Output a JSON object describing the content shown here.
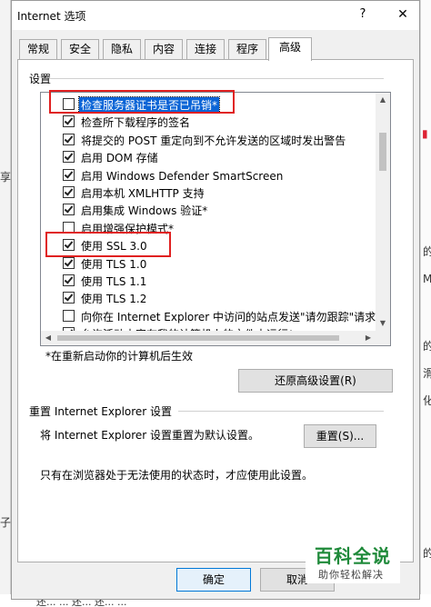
{
  "window": {
    "title": "Internet 选项",
    "help_glyph": "?",
    "close_glyph": "✕"
  },
  "tabs": [
    {
      "label": "常规"
    },
    {
      "label": "安全"
    },
    {
      "label": "隐私"
    },
    {
      "label": "内容"
    },
    {
      "label": "连接"
    },
    {
      "label": "程序"
    },
    {
      "label": "高级"
    }
  ],
  "active_tab": "高级",
  "settings_group_label": "设置",
  "settings": [
    {
      "label": "检查服务器证书是否已吊销*",
      "checked": false,
      "selected": true
    },
    {
      "label": "检查所下载程序的签名",
      "checked": true
    },
    {
      "label": "将提交的 POST 重定向到不允许发送的区域时发出警告",
      "checked": true
    },
    {
      "label": "启用 DOM 存储",
      "checked": true
    },
    {
      "label": "启用 Windows Defender SmartScreen",
      "checked": true
    },
    {
      "label": "启用本机 XMLHTTP 支持",
      "checked": true
    },
    {
      "label": "启用集成 Windows 验证*",
      "checked": true
    },
    {
      "label": "启用增强保护模式*",
      "checked": false
    },
    {
      "label": "使用 SSL 3.0",
      "checked": true
    },
    {
      "label": "使用 TLS 1.0",
      "checked": true
    },
    {
      "label": "使用 TLS 1.1",
      "checked": true
    },
    {
      "label": "使用 TLS 1.2",
      "checked": true
    },
    {
      "label": "向你在 Internet Explorer 中访问的站点发送\"请勿跟踪\"请求*",
      "checked": false
    },
    {
      "label": "允许活动内容在我的计算机上的文件中运行*",
      "checked": true
    }
  ],
  "restart_note": "*在重新启动你的计算机后生效",
  "restore_advanced_button": "还原高级设置(R)",
  "reset_section_label": "重置 Internet Explorer 设置",
  "reset_description": "将 Internet Explorer 设置重置为默认设置。",
  "reset_button": "重置(S)...",
  "reset_hint": "只有在浏览器处于无法使用的状态时，才应使用此设置。",
  "ok_button": "确定",
  "cancel_button": "取消",
  "watermark": {
    "title": "百科全说",
    "subtitle": "助你轻松解决"
  },
  "background": {
    "left_glyphs": [
      "享",
      "子"
    ],
    "right_glyphs": [
      "的",
      "M",
      "的",
      "滑",
      "化",
      "的"
    ],
    "bottom_text": "   还...   ...     还...  还...   ...   "
  },
  "colors": {
    "highlight_box": "#e02020",
    "selection": "#0a64d6",
    "watermark_green": "#1f8a3a"
  }
}
